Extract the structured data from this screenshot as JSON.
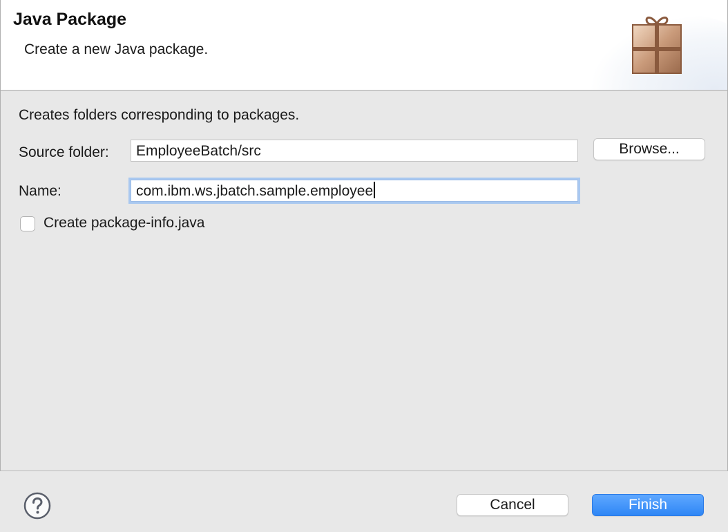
{
  "header": {
    "title": "Java Package",
    "subtitle": "Create a new Java package."
  },
  "body": {
    "intro": "Creates folders corresponding to packages.",
    "source_folder": {
      "label": "Source folder:",
      "value": "EmployeeBatch/src",
      "browse_label": "Browse..."
    },
    "name": {
      "label": "Name:",
      "value": "com.ibm.ws.jbatch.sample.employee"
    },
    "package_info": {
      "label": "Create package-info.java",
      "checked": false
    }
  },
  "footer": {
    "help_icon": "question-mark-icon",
    "cancel_label": "Cancel",
    "finish_label": "Finish"
  },
  "colors": {
    "accent": "#2e86f5",
    "focus_ring": "#a9c8f0",
    "background": "#e8e8e8"
  }
}
